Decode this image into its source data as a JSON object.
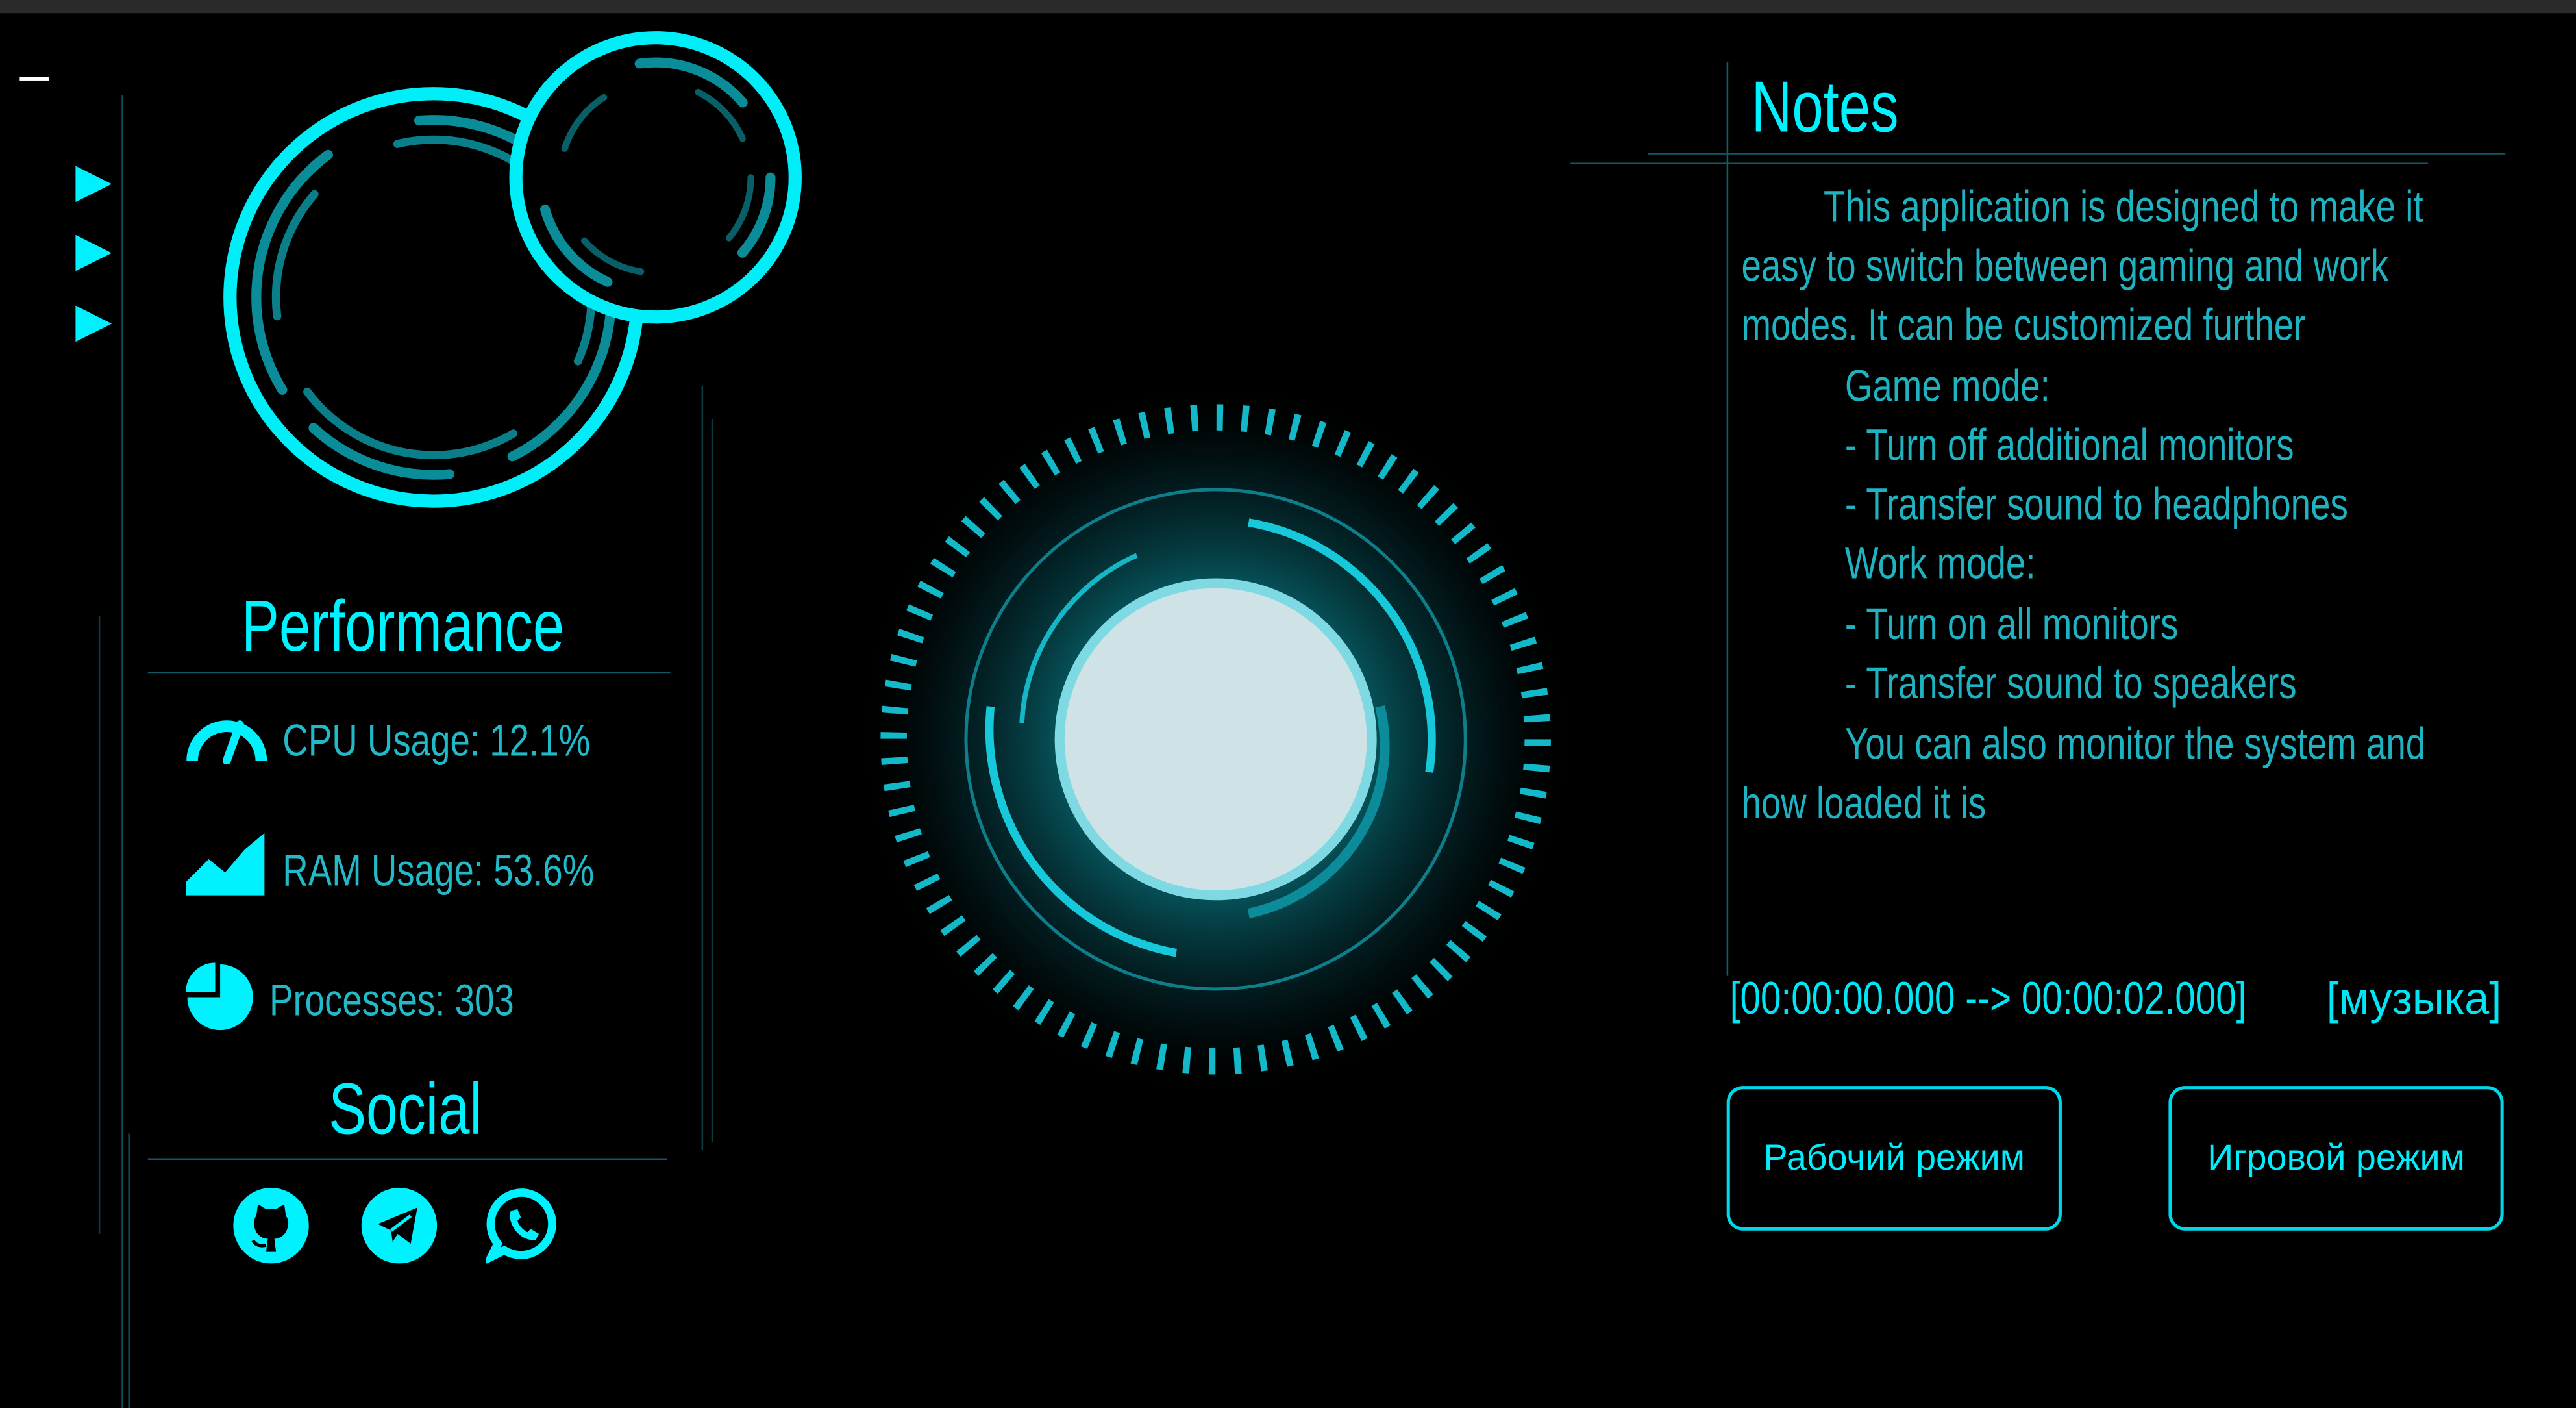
{
  "window": {
    "minimize_label": "minimize"
  },
  "sidebar": {
    "nav_items": [
      "play-arrow-1",
      "play-arrow-2",
      "play-arrow-3"
    ]
  },
  "performance": {
    "title": "Performance",
    "cpu": "CPU Usage: 12.1%",
    "ram": "RAM Usage: 53.6%",
    "processes": "Processes: 303"
  },
  "social": {
    "title": "Social",
    "links": [
      "github-icon",
      "telegram-icon",
      "whatsapp-icon"
    ]
  },
  "notes": {
    "title": "Notes",
    "lines": [
      "This application is designed to make it",
      "easy to switch between gaming and work",
      "modes. It can be customized further",
      "Game mode:",
      "- Turn off additional monitors",
      "- Transfer sound to headphones",
      "Work mode:",
      "- Turn on all monitors",
      "- Transfer sound to speakers",
      "You can also monitor the system and",
      "how loaded it is"
    ]
  },
  "subtitle": {
    "timestamp": "[00:00:00.000 --> 00:00:02.000]",
    "text": "[музыка]"
  },
  "modes": {
    "work_label": "Рабочий режим",
    "game_label": "Игровой режим"
  },
  "colors": {
    "accent": "#00f2ff",
    "text": "#1fb3c2",
    "background": "#000000"
  }
}
